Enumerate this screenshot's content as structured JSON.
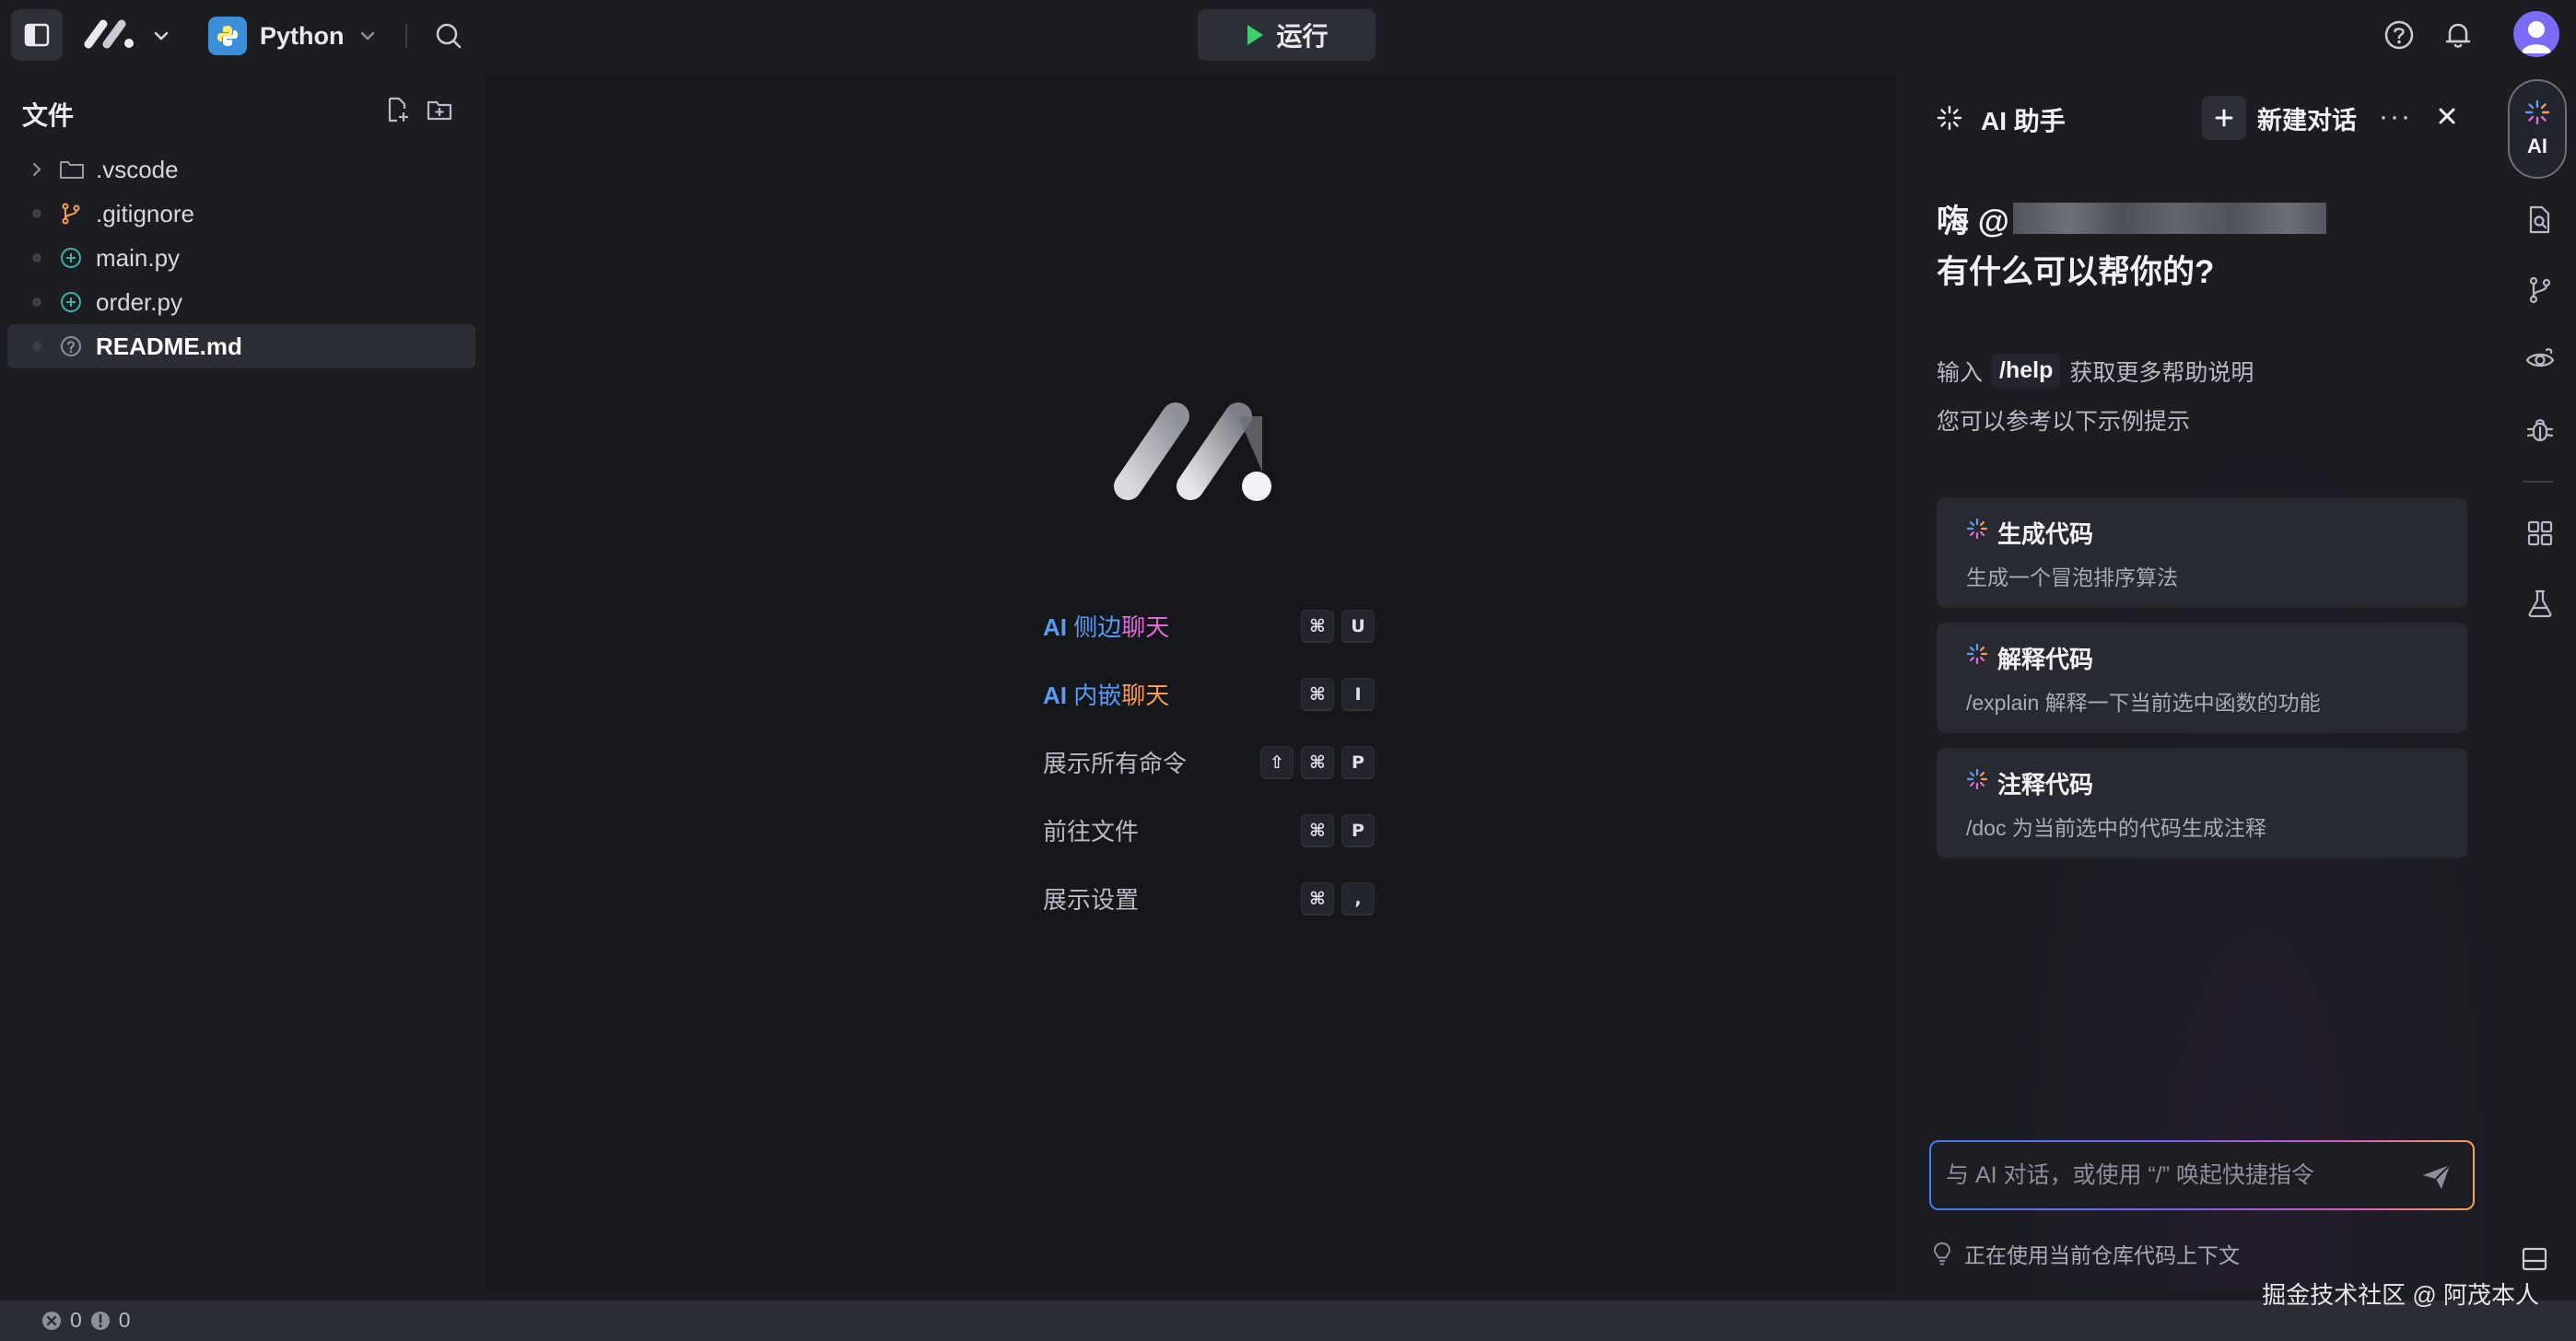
{
  "topbar": {
    "language": "Python",
    "run_label": "运行"
  },
  "explorer": {
    "title": "文件",
    "items": [
      {
        "label": ".vscode",
        "kind": "folder"
      },
      {
        "label": ".gitignore",
        "kind": "git"
      },
      {
        "label": "main.py",
        "kind": "python"
      },
      {
        "label": "order.py",
        "kind": "python"
      },
      {
        "label": "README.md",
        "kind": "markdown",
        "active": true
      }
    ]
  },
  "welcome": {
    "shortcuts": [
      {
        "label_ai": "AI",
        "label_rest_1": "侧边",
        "label_rest_2": "聊天",
        "keys": [
          "⌘",
          "U"
        ]
      },
      {
        "label_ai": "AI",
        "label_rest_1": "内嵌",
        "label_rest_2": "聊天",
        "keys": [
          "⌘",
          "I"
        ]
      },
      {
        "label": "展示所有命令",
        "keys": [
          "⇧",
          "⌘",
          "P"
        ]
      },
      {
        "label": "前往文件",
        "keys": [
          "⌘",
          "P"
        ]
      },
      {
        "label": "展示设置",
        "keys": [
          "⌘",
          ","
        ]
      }
    ]
  },
  "ai_panel": {
    "title": "AI 助手",
    "new_chat": "新建对话",
    "more": "···",
    "greeting_prefix": "嗨 @",
    "greeting_line2": "有什么可以帮你的?",
    "help_prefix": "输入",
    "help_command": "/help",
    "help_suffix": "获取更多帮助说明",
    "hint": "您可以参考以下示例提示",
    "cards": [
      {
        "title": "生成代码",
        "desc": "生成一个冒泡排序算法"
      },
      {
        "title": "解释代码",
        "desc": "/explain 解释一下当前选中函数的功能"
      },
      {
        "title": "注释代码",
        "desc": "/doc 为当前选中的代码生成注释"
      }
    ],
    "input_placeholder": "与 AI 对话，或使用 “/” 唤起快捷指令",
    "context": "正在使用当前仓库代码上下文"
  },
  "activity": {
    "ai_label": "AI"
  },
  "statusbar": {
    "errors": "0",
    "warnings": "0"
  },
  "watermark": "掘金技术社区 @ 阿茂本人",
  "colors": {
    "accent_blue": "#5b9bf5",
    "gradient_orange": "#f59a5b",
    "gradient_pink": "#e06bd6",
    "run_green": "#3ecf6e",
    "python_badge": "#3b8fd9"
  }
}
